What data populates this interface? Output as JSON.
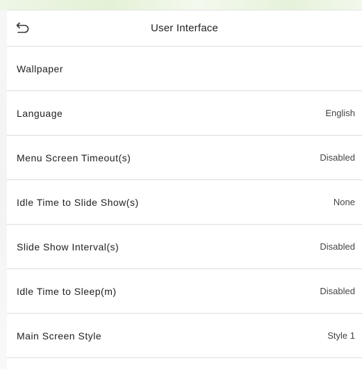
{
  "header": {
    "title": "User Interface",
    "back_icon": "back-arrow-icon"
  },
  "settings": [
    {
      "label": "Wallpaper",
      "value": ""
    },
    {
      "label": "Language",
      "value": "English"
    },
    {
      "label": "Menu Screen Timeout(s)",
      "value": "Disabled"
    },
    {
      "label": "Idle Time to Slide Show(s)",
      "value": "None"
    },
    {
      "label": "Slide Show Interval(s)",
      "value": "Disabled"
    },
    {
      "label": "Idle Time to Sleep(m)",
      "value": "Disabled"
    },
    {
      "label": "Main Screen Style",
      "value": "Style 1"
    }
  ]
}
